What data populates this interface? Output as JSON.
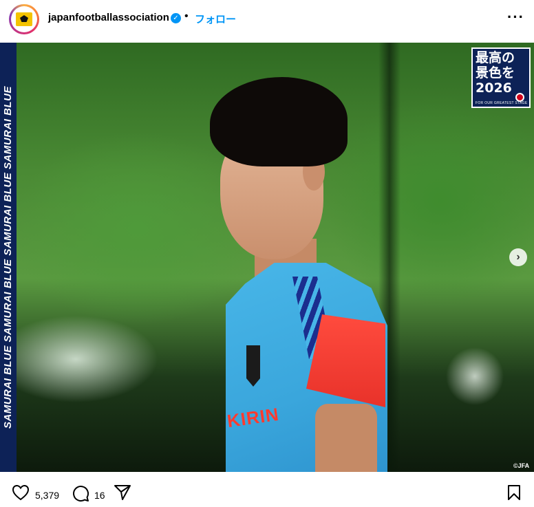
{
  "post": {
    "username": "japanfootballassociation",
    "verified_mark": "✓",
    "separator": "•",
    "follow_label": "フォロー",
    "more_label": "···"
  },
  "image": {
    "side_text": "SAMURAI BLUE SAMURAI BLUE SAMURAI BLUE SAMURAI BLUE",
    "badge_lines": [
      "最高の",
      "景色を",
      "2026"
    ],
    "badge_small": "FOR OUR GREATEST STAGE",
    "sponsor_text": "KIRIN",
    "copyright": "©JFA",
    "next_icon": "›"
  },
  "actions": {
    "likes": "5,379",
    "comments": "16",
    "icons": [
      "heart-icon",
      "comment-icon",
      "share-icon",
      "bookmark-icon"
    ]
  },
  "colors": {
    "accent": "#0095f6",
    "navy": "#0d2257",
    "kit_blue": "#3aa6dc",
    "kit_red": "#e8322a"
  }
}
